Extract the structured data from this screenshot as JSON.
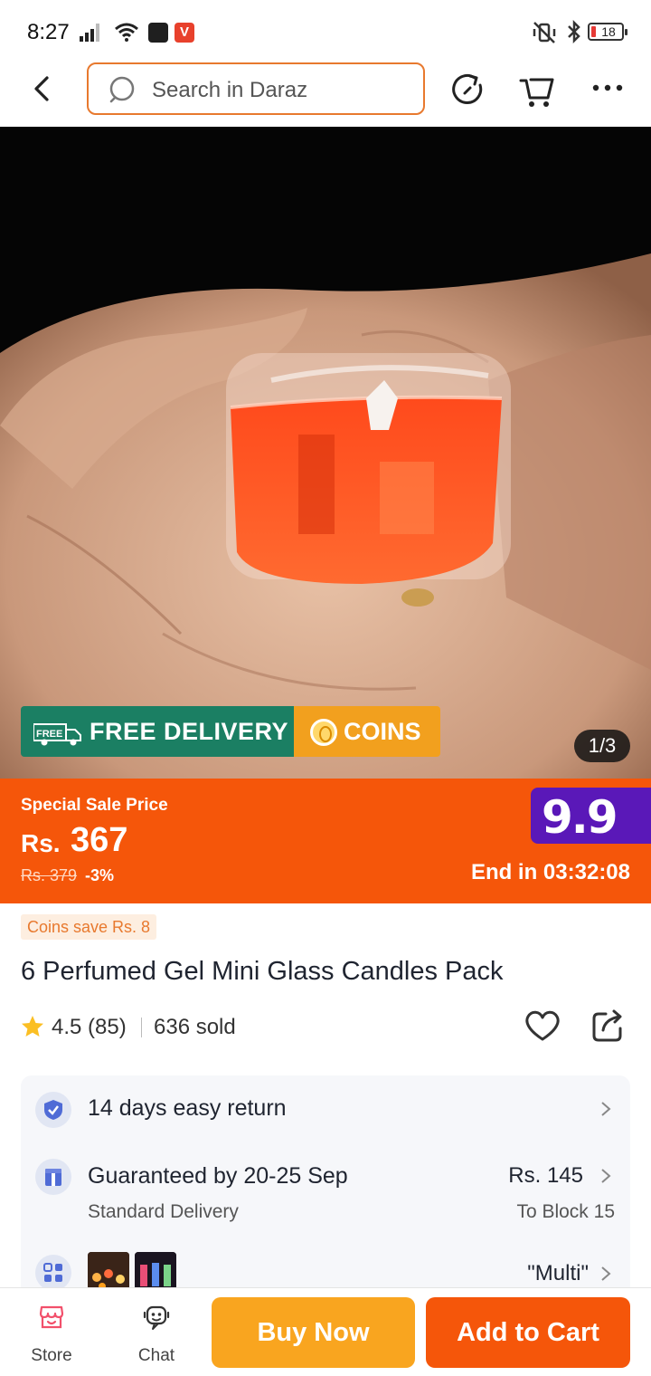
{
  "status_bar": {
    "time": "8:27",
    "battery_level": "18"
  },
  "search": {
    "placeholder": "Search in Daraz"
  },
  "product_image": {
    "free_delivery_label": "FREE DELIVERY",
    "truck_badge_text": "FREE",
    "coins_label": "COINS",
    "counter": "1/3"
  },
  "price": {
    "special_label": "Special Sale Price",
    "currency": "Rs.",
    "value": "367",
    "old_price": "Rs. 379",
    "discount": "-3%",
    "campaign": "9.9",
    "timer": "End in 03:32:08"
  },
  "details": {
    "coins_save": "Coins save Rs. 8",
    "title": "6 Perfumed Gel Mini Glass Candles Pack",
    "rating": "4.5 (85)",
    "sold": "636 sold"
  },
  "info": {
    "return_text": "14 days easy return",
    "guarantee_text": "Guaranteed by 20-25 Sep",
    "delivery_type": "Standard Delivery",
    "delivery_price": "Rs. 145",
    "delivery_location": "To Block 15",
    "variant_text": "\"Multi\""
  },
  "bottom_bar": {
    "store_label": "Store",
    "chat_label": "Chat",
    "buy_now_label": "Buy Now",
    "add_to_cart_label": "Add to Cart"
  },
  "colors": {
    "brand_orange": "#f5560a",
    "buy_now": "#f9a51f",
    "free_delivery_green": "#1b7f63",
    "campaign_purple": "#5a18b8"
  }
}
